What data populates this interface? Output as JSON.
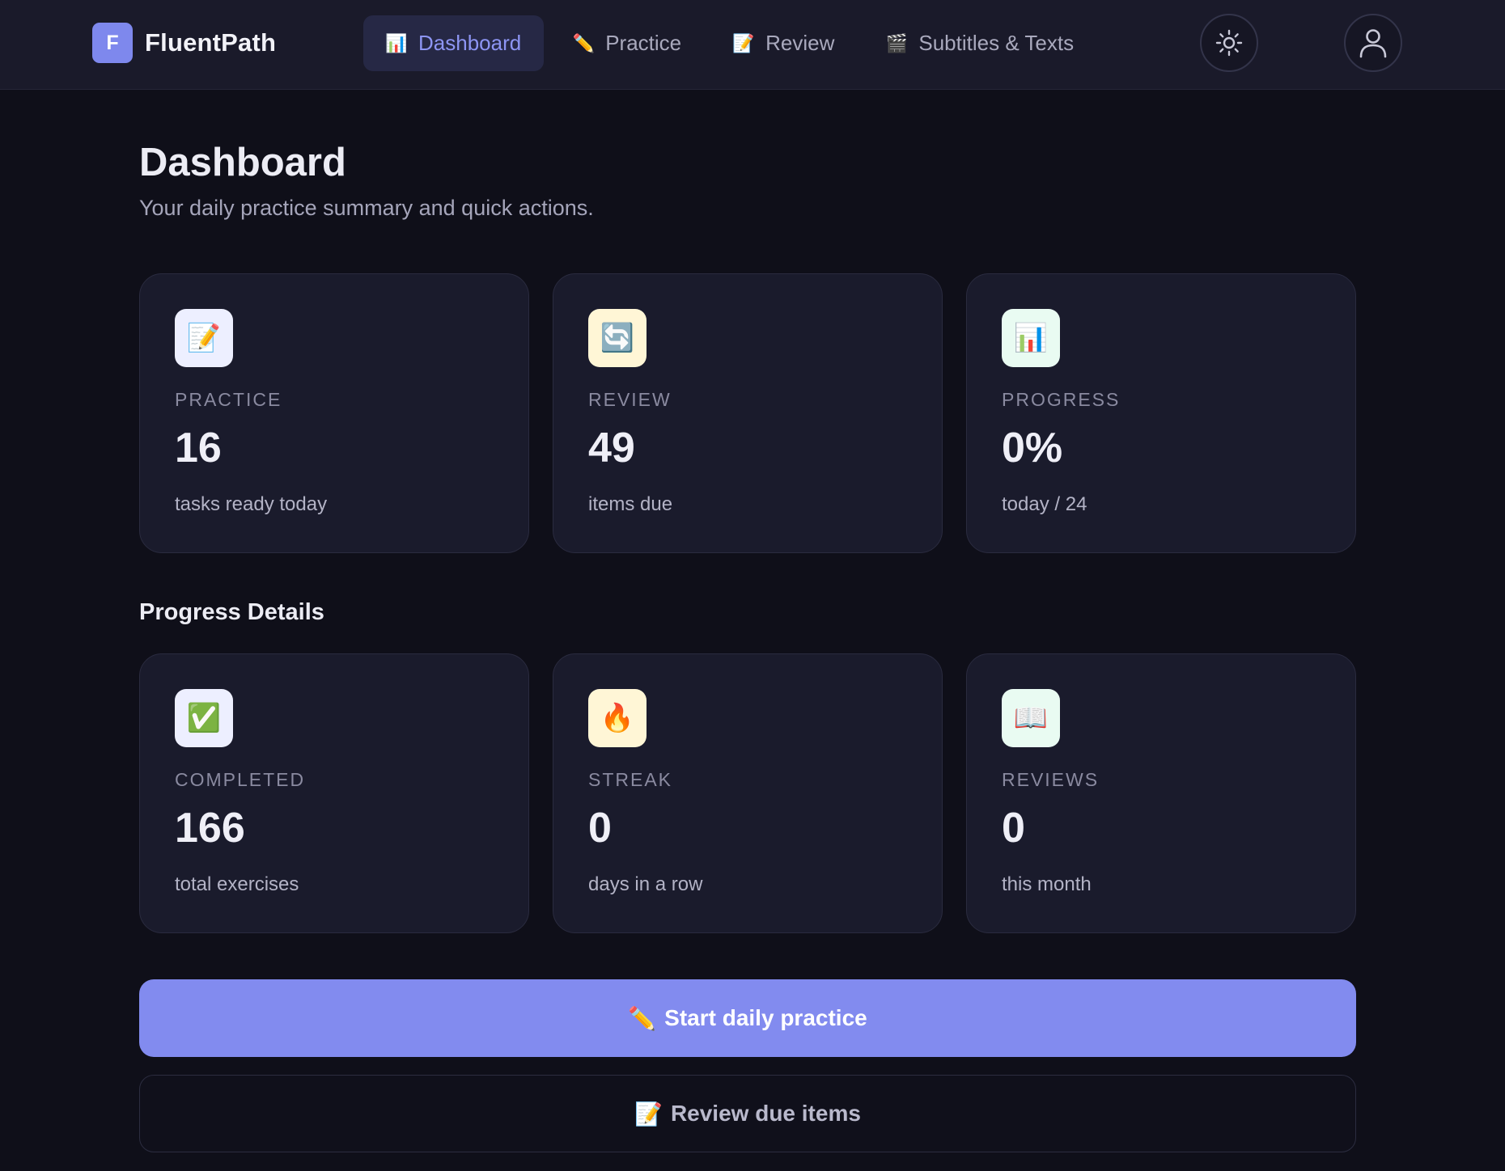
{
  "brand": {
    "logo_letter": "F",
    "name": "FluentPath"
  },
  "nav": {
    "items": [
      {
        "icon": "📊",
        "icon_name": "bar-chart-icon",
        "label": "Dashboard",
        "active": true
      },
      {
        "icon": "✏️",
        "icon_name": "pencil-icon",
        "label": "Practice",
        "active": false
      },
      {
        "icon": "📝",
        "icon_name": "memo-icon",
        "label": "Review",
        "active": false
      },
      {
        "icon": "🎬",
        "icon_name": "clapper-board-icon",
        "label": "Subtitles & Texts",
        "active": false
      }
    ]
  },
  "header_actions": {
    "theme_icon": "sun-icon",
    "profile_icon": "user-icon"
  },
  "page": {
    "title": "Dashboard",
    "subtitle": "Your daily practice summary and quick actions."
  },
  "summary_cards": [
    {
      "icon": "📝",
      "icon_name": "memo-icon",
      "label": "PRACTICE",
      "value": "16",
      "caption": "tasks ready today"
    },
    {
      "icon": "🔄",
      "icon_name": "refresh-icon",
      "label": "REVIEW",
      "value": "49",
      "caption": "items due"
    },
    {
      "icon": "📊",
      "icon_name": "bar-chart-icon",
      "label": "PROGRESS",
      "value": "0%",
      "caption": "today / 24"
    }
  ],
  "details": {
    "section_title": "Progress Details",
    "cards": [
      {
        "icon": "✅",
        "icon_name": "check-mark-icon",
        "label": "COMPLETED",
        "value": "166",
        "caption": "total exercises"
      },
      {
        "icon": "🔥",
        "icon_name": "fire-icon",
        "label": "STREAK",
        "value": "0",
        "caption": "days in a row"
      },
      {
        "icon": "📖",
        "icon_name": "open-book-icon",
        "label": "REVIEWS",
        "value": "0",
        "caption": "this month"
      }
    ]
  },
  "actions": {
    "primary_icon": "✏️",
    "primary_label": "Start daily practice",
    "secondary_icon": "📝",
    "secondary_label": "Review due items"
  },
  "colors": {
    "background": "#0f0f19",
    "header": "#1a1a2a",
    "card": "#1a1b2c",
    "accent": "#828bef",
    "active_nav_text": "#8d95f3"
  }
}
